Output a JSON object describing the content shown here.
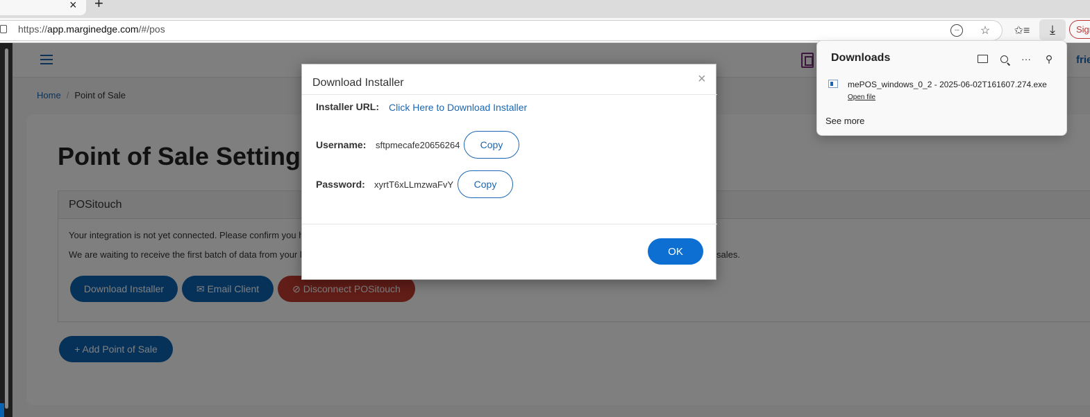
{
  "browser": {
    "tab_close": "×",
    "new_tab": "+",
    "url_scheme": "https://",
    "url_host": "app.marginedge.com",
    "url_path": "/#/pos",
    "signin_label": "Sign"
  },
  "app": {
    "header_friend": "friend",
    "breadcrumb": {
      "home": "Home",
      "separator": "/",
      "current": "Point of Sale"
    },
    "page_title": "Point of Sale Settings",
    "panel": {
      "title": "POSitouch",
      "line1": "Your integration is not yet connected. Please confirm you h",
      "line2_start": "We are waiting to receive the first batch of data from your l",
      "line2_end": "sales."
    },
    "buttons": {
      "download_installer": "Download Installer",
      "email_client": "✉ Email Client",
      "disconnect": "⊘ Disconnect POSitouch",
      "add_pos": "+ Add Point of Sale"
    }
  },
  "modal": {
    "title": "Download Installer",
    "close": "×",
    "installer_url_label": "Installer URL:",
    "installer_url_link": "Click Here to Download Installer",
    "username_label": "Username:",
    "username_value": "sftpmecafe20656264",
    "password_label": "Password:",
    "password_value": "xyrtT6xLLmzwaFvY",
    "copy_label": "Copy",
    "ok_label": "OK"
  },
  "downloads": {
    "title": "Downloads",
    "more": "···",
    "file_name": "mePOS_windows_0_2 - 2025-06-02T161607.274.exe",
    "open_file": "Open file",
    "see_more": "See more"
  },
  "colors": {
    "primary": "#0d65b4",
    "danger": "#c23a2e",
    "link": "#1a66b3"
  }
}
